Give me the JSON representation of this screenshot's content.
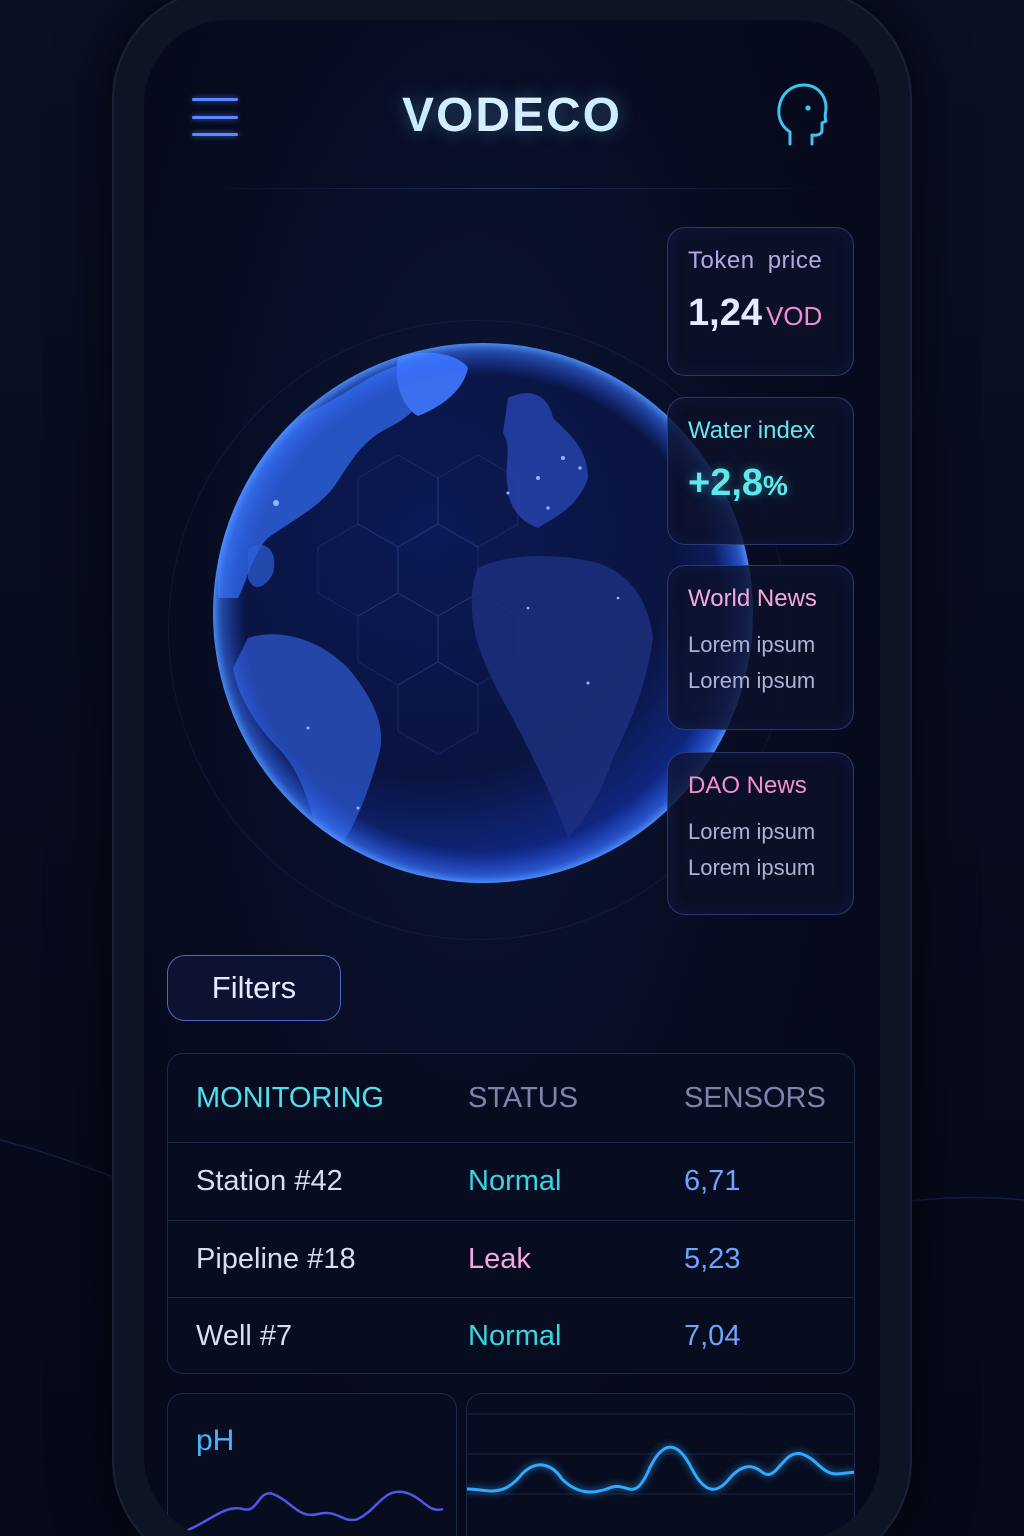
{
  "header": {
    "title": "VODECO",
    "menu_icon": "hamburger-menu-icon",
    "profile_icon": "head-profile-icon"
  },
  "cards": {
    "token": {
      "label": "Token  price",
      "value": "1,24",
      "unit": "VOD"
    },
    "water": {
      "label": "Water index",
      "value": "+2,8",
      "unit": "%"
    },
    "world_news": {
      "label": "World News",
      "lines": [
        "Lorem ipsum",
        "Lorem ipsum"
      ]
    },
    "dao_news": {
      "label": "DAO News",
      "lines": [
        "Lorem ipsum",
        "Lorem ipsum"
      ]
    }
  },
  "filters": {
    "label": "Filters"
  },
  "table": {
    "headers": [
      "MONITORING",
      "STATUS",
      "SENSORS"
    ],
    "rows": [
      {
        "name": "Station #42",
        "status": "Normal",
        "value": "6,71"
      },
      {
        "name": "Pipeline #18",
        "status": "Leak",
        "value": "5,23"
      },
      {
        "name": "Well #7",
        "status": "Normal",
        "value": "7,04"
      }
    ]
  },
  "mini_charts": {
    "ph_label": "pH"
  },
  "colors": {
    "accent_cyan": "#4fe0ee",
    "accent_pink": "#f3a8e1",
    "accent_blue": "#5b87ff",
    "background": "#070b1c"
  }
}
